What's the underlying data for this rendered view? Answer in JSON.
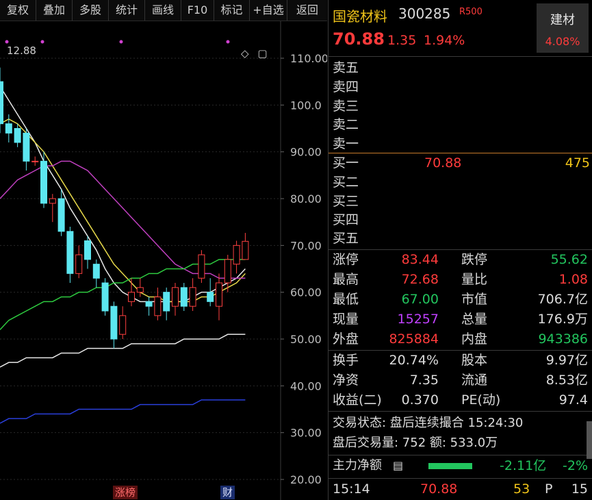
{
  "toolbar": [
    "复权",
    "叠加",
    "多股",
    "统计",
    "画线",
    "F10",
    "标记",
    "+自选",
    "返回"
  ],
  "chart": {
    "ref_label": "12.88",
    "y_ticks": [
      "110.00",
      "100.0",
      "90.00",
      "80.00",
      "70.00",
      "60.00",
      "50.00",
      "40.00",
      "30.00",
      "20.00"
    ],
    "tag_zhangbang": "涨榜",
    "tag_cai": "财",
    "diamond_icon": "◇",
    "window_icon": "▢"
  },
  "chart_data": {
    "type": "candlestick",
    "ylim": [
      20,
      110
    ],
    "candles": [
      {
        "o": 105,
        "c": 96,
        "h": 108,
        "l": 94
      },
      {
        "o": 96,
        "c": 94,
        "h": 98,
        "l": 92
      },
      {
        "o": 95,
        "c": 92,
        "h": 96,
        "l": 91
      },
      {
        "o": 94,
        "c": 88,
        "h": 95,
        "l": 86
      },
      {
        "o": 88,
        "c": 88,
        "h": 89,
        "l": 87
      },
      {
        "o": 88,
        "c": 79,
        "h": 90,
        "l": 78
      },
      {
        "o": 79,
        "c": 80,
        "h": 81,
        "l": 75
      },
      {
        "o": 80,
        "c": 73,
        "h": 82,
        "l": 72
      },
      {
        "o": 73,
        "c": 64,
        "h": 74,
        "l": 62
      },
      {
        "o": 64,
        "c": 68,
        "h": 70,
        "l": 63
      },
      {
        "o": 71,
        "c": 67,
        "h": 72,
        "l": 65
      },
      {
        "o": 66,
        "c": 63,
        "h": 67,
        "l": 61
      },
      {
        "o": 62,
        "c": 56,
        "h": 63,
        "l": 55
      },
      {
        "o": 57,
        "c": 50,
        "h": 58,
        "l": 48
      },
      {
        "o": 51,
        "c": 55,
        "h": 57,
        "l": 50
      },
      {
        "o": 58,
        "c": 60,
        "h": 63,
        "l": 57
      },
      {
        "o": 60,
        "c": 61,
        "h": 63,
        "l": 59
      },
      {
        "o": 58,
        "c": 57,
        "h": 59,
        "l": 55
      },
      {
        "o": 55,
        "c": 59,
        "h": 61,
        "l": 54
      },
      {
        "o": 60,
        "c": 56,
        "h": 61,
        "l": 54
      },
      {
        "o": 57,
        "c": 61,
        "h": 62,
        "l": 55
      },
      {
        "o": 61,
        "c": 57,
        "h": 62,
        "l": 56
      },
      {
        "o": 57,
        "c": 61,
        "h": 63,
        "l": 56
      },
      {
        "o": 63,
        "c": 68,
        "h": 69,
        "l": 62
      },
      {
        "o": 60,
        "c": 58,
        "h": 63,
        "l": 57
      },
      {
        "o": 57,
        "c": 62,
        "h": 64,
        "l": 54
      },
      {
        "o": 62,
        "c": 67,
        "h": 68,
        "l": 60
      },
      {
        "o": 66,
        "c": 70,
        "h": 71,
        "l": 64
      },
      {
        "o": 67,
        "c": 70.88,
        "h": 72.68,
        "l": 67
      }
    ],
    "series": [
      {
        "color": "#e8e8e8",
        "values": [
          104,
          101,
          98,
          95,
          92,
          88,
          85,
          82,
          78,
          75,
          72,
          69,
          65,
          62,
          60,
          59,
          58,
          58,
          58,
          58,
          58,
          58,
          59,
          60,
          60,
          61,
          62,
          63,
          65
        ]
      },
      {
        "color": "#e6d84a",
        "values": [
          96,
          97,
          96,
          94,
          92,
          90,
          87,
          84,
          81,
          78,
          75,
          72,
          69,
          66,
          64,
          62,
          60,
          59,
          59,
          58,
          58,
          58,
          58,
          59,
          59,
          60,
          61,
          62,
          64
        ]
      },
      {
        "color": "#c040c0",
        "values": [
          80,
          82,
          84,
          85,
          86,
          87,
          87,
          88,
          88,
          87,
          86,
          84,
          82,
          80,
          78,
          76,
          74,
          72,
          70,
          68,
          66,
          65,
          64,
          64,
          64,
          63,
          63,
          63,
          63
        ]
      },
      {
        "color": "#2ecc40",
        "values": [
          52,
          54,
          55,
          56,
          57,
          58,
          58,
          59,
          59,
          60,
          60,
          61,
          61,
          62,
          62,
          63,
          63,
          64,
          64,
          65,
          65,
          65,
          66,
          66,
          66,
          67,
          67,
          67,
          67
        ]
      },
      {
        "color": "#e8e8e8",
        "values": [
          44,
          45,
          45,
          46,
          46,
          46,
          46,
          47,
          47,
          47,
          48,
          48,
          48,
          48,
          48,
          49,
          49,
          49,
          49,
          49,
          49,
          50,
          50,
          50,
          50,
          50,
          51,
          51,
          51
        ]
      },
      {
        "color": "#2a3fdc",
        "values": [
          32,
          33,
          33,
          33,
          34,
          34,
          34,
          34,
          34,
          35,
          35,
          35,
          35,
          35,
          35,
          35,
          36,
          36,
          36,
          36,
          36,
          36,
          36,
          37,
          37,
          37,
          37,
          37,
          37
        ]
      }
    ]
  },
  "panel": {
    "name": "国瓷材料",
    "code": "300285",
    "r_tag": "R500",
    "price": "70.88",
    "change": "1.35",
    "change_pct": "1.94%",
    "sector_name": "建材",
    "sector_pct": "4.08%",
    "sells": [
      "卖五",
      "卖四",
      "卖三",
      "卖二",
      "卖一"
    ],
    "buys": [
      {
        "label": "买一",
        "price": "70.88",
        "vol": "475"
      },
      {
        "label": "买二",
        "price": "",
        "vol": ""
      },
      {
        "label": "买三",
        "price": "",
        "vol": ""
      },
      {
        "label": "买四",
        "price": "",
        "vol": ""
      },
      {
        "label": "买五",
        "price": "",
        "vol": ""
      }
    ],
    "stats1": [
      [
        "涨停",
        "83.44",
        "跌停",
        "55.62"
      ],
      [
        "最高",
        "72.68",
        "量比",
        "1.08"
      ],
      [
        "最低",
        "67.00",
        "市值",
        "706.7亿"
      ],
      [
        "现量",
        "15257",
        "总量",
        "176.9万"
      ],
      [
        "外盘",
        "825884",
        "内盘",
        "943386"
      ]
    ],
    "stats2": [
      [
        "换手",
        "20.74%",
        "股本",
        "9.97亿"
      ],
      [
        "净资",
        "7.35",
        "流通",
        "8.53亿"
      ],
      [
        "收益(二)",
        "0.370",
        "PE(动)",
        "97.4"
      ]
    ],
    "status": "交易状态: 盘后连续撮合 15:24:30",
    "after_vol": "盘后交易量: 752  额: 533.0万",
    "main_flow_label": "主力净额",
    "main_flow_value": "-2.11亿",
    "main_flow_pct": "-2%",
    "tick_time": "15:14",
    "tick_price": "70.88",
    "tick_vol": "53",
    "tick_side": "P",
    "tick_count": "15"
  }
}
